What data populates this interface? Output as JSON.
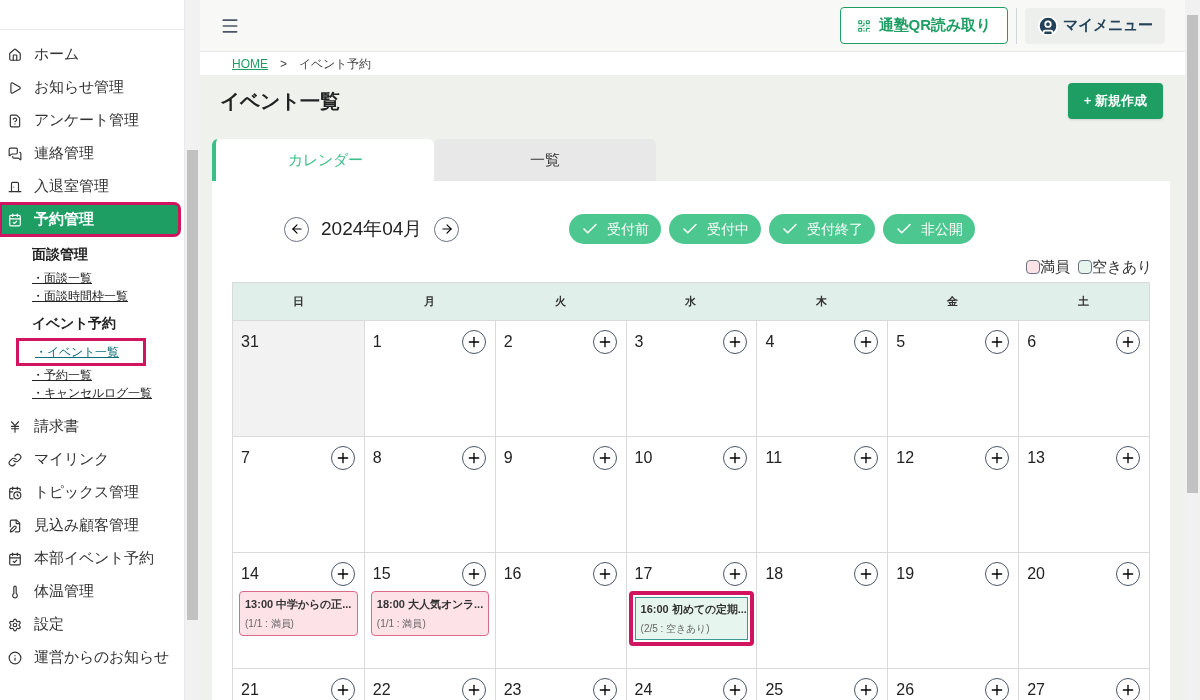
{
  "sidebar": {
    "items": [
      {
        "label": "ホーム",
        "selected": false,
        "highlighted": false
      },
      {
        "label": "お知らせ管理",
        "selected": false,
        "highlighted": false
      },
      {
        "label": "アンケート管理",
        "selected": false,
        "highlighted": false
      },
      {
        "label": "連絡管理",
        "selected": false,
        "highlighted": false
      },
      {
        "label": "入退室管理",
        "selected": false,
        "highlighted": false
      },
      {
        "label": "予約管理",
        "selected": true,
        "highlighted": true,
        "children": [
          {
            "heading": "面談管理",
            "links": [
              {
                "label": "・面談一覧",
                "selected": false,
                "highlighted": false
              },
              {
                "label": "・面談時間枠一覧",
                "selected": false,
                "highlighted": false
              }
            ]
          },
          {
            "heading": "イベント予約",
            "links": [
              {
                "label": "・イベント一覧",
                "selected": true,
                "highlighted": true
              },
              {
                "label": "・予約一覧",
                "selected": false,
                "highlighted": false
              },
              {
                "label": "・キャンセルログ一覧",
                "selected": false,
                "highlighted": false
              }
            ]
          }
        ]
      },
      {
        "label": "請求書",
        "selected": false,
        "highlighted": false
      },
      {
        "label": "マイリンク",
        "selected": false,
        "highlighted": false
      },
      {
        "label": "トピックス管理",
        "selected": false,
        "highlighted": false
      },
      {
        "label": "見込み顧客管理",
        "selected": false,
        "highlighted": false
      },
      {
        "label": "本部イベント予約",
        "selected": false,
        "highlighted": false
      },
      {
        "label": "体温管理",
        "selected": false,
        "highlighted": false
      },
      {
        "label": "設定",
        "selected": false,
        "highlighted": false
      },
      {
        "label": "運営からのお知らせ",
        "selected": false,
        "highlighted": false
      }
    ]
  },
  "header": {
    "qr_button": "通塾QR読み取り",
    "my_menu": "マイメニュー"
  },
  "breadcrumb": [
    "HOME",
    ">",
    "イベント予約"
  ],
  "page_title": "イベント一覧",
  "new_button": "+ 新規作成",
  "tabs": [
    {
      "label": "カレンダー",
      "selected": true
    },
    {
      "label": "一覧",
      "selected": false
    }
  ],
  "month": "2024年04月",
  "filters": [
    {
      "label": "受付前",
      "checked": true
    },
    {
      "label": "受付中",
      "checked": true
    },
    {
      "label": "受付終了",
      "checked": true
    },
    {
      "label": "非公開",
      "checked": true
    }
  ],
  "legend": [
    {
      "label": "満員",
      "color": "#fde2e8"
    },
    {
      "label": "空きあり",
      "color": "#e6f6ef"
    }
  ],
  "weekdays": [
    "日",
    "月",
    "火",
    "水",
    "木",
    "金",
    "土"
  ],
  "weeks": [
    [
      {
        "day": "31",
        "other_month": true
      },
      {
        "day": "1",
        "other_month": false
      },
      {
        "day": "2",
        "other_month": false
      },
      {
        "day": "3",
        "other_month": false
      },
      {
        "day": "4",
        "other_month": false
      },
      {
        "day": "5",
        "other_month": false
      },
      {
        "day": "6",
        "other_month": false
      }
    ],
    [
      {
        "day": "7",
        "other_month": false
      },
      {
        "day": "8",
        "other_month": false
      },
      {
        "day": "9",
        "other_month": false
      },
      {
        "day": "10",
        "other_month": false
      },
      {
        "day": "11",
        "other_month": false
      },
      {
        "day": "12",
        "other_month": false
      },
      {
        "day": "13",
        "other_month": false
      }
    ],
    [
      {
        "day": "14",
        "other_month": false,
        "events": [
          {
            "title": "13:00 中学からの正...",
            "capacity": "(1/1 : 満員)",
            "kind": "full",
            "highlighted": false
          }
        ]
      },
      {
        "day": "15",
        "other_month": false,
        "events": [
          {
            "title": "18:00 大人気オンラ...",
            "capacity": "(1/1 : 満員)",
            "kind": "full",
            "highlighted": false
          }
        ]
      },
      {
        "day": "16",
        "other_month": false
      },
      {
        "day": "17",
        "other_month": false,
        "events": [
          {
            "title": "16:00 初めての定期...",
            "capacity": "(2/5 : 空きあり)",
            "kind": "available",
            "highlighted": true
          }
        ]
      },
      {
        "day": "18",
        "other_month": false
      },
      {
        "day": "19",
        "other_month": false
      },
      {
        "day": "20",
        "other_month": false
      }
    ],
    [
      {
        "day": "21",
        "other_month": false
      },
      {
        "day": "22",
        "other_month": false
      },
      {
        "day": "23",
        "other_month": false
      },
      {
        "day": "24",
        "other_month": false
      },
      {
        "day": "25",
        "other_month": false
      },
      {
        "day": "26",
        "other_month": false
      },
      {
        "day": "27",
        "other_month": false
      }
    ]
  ]
}
